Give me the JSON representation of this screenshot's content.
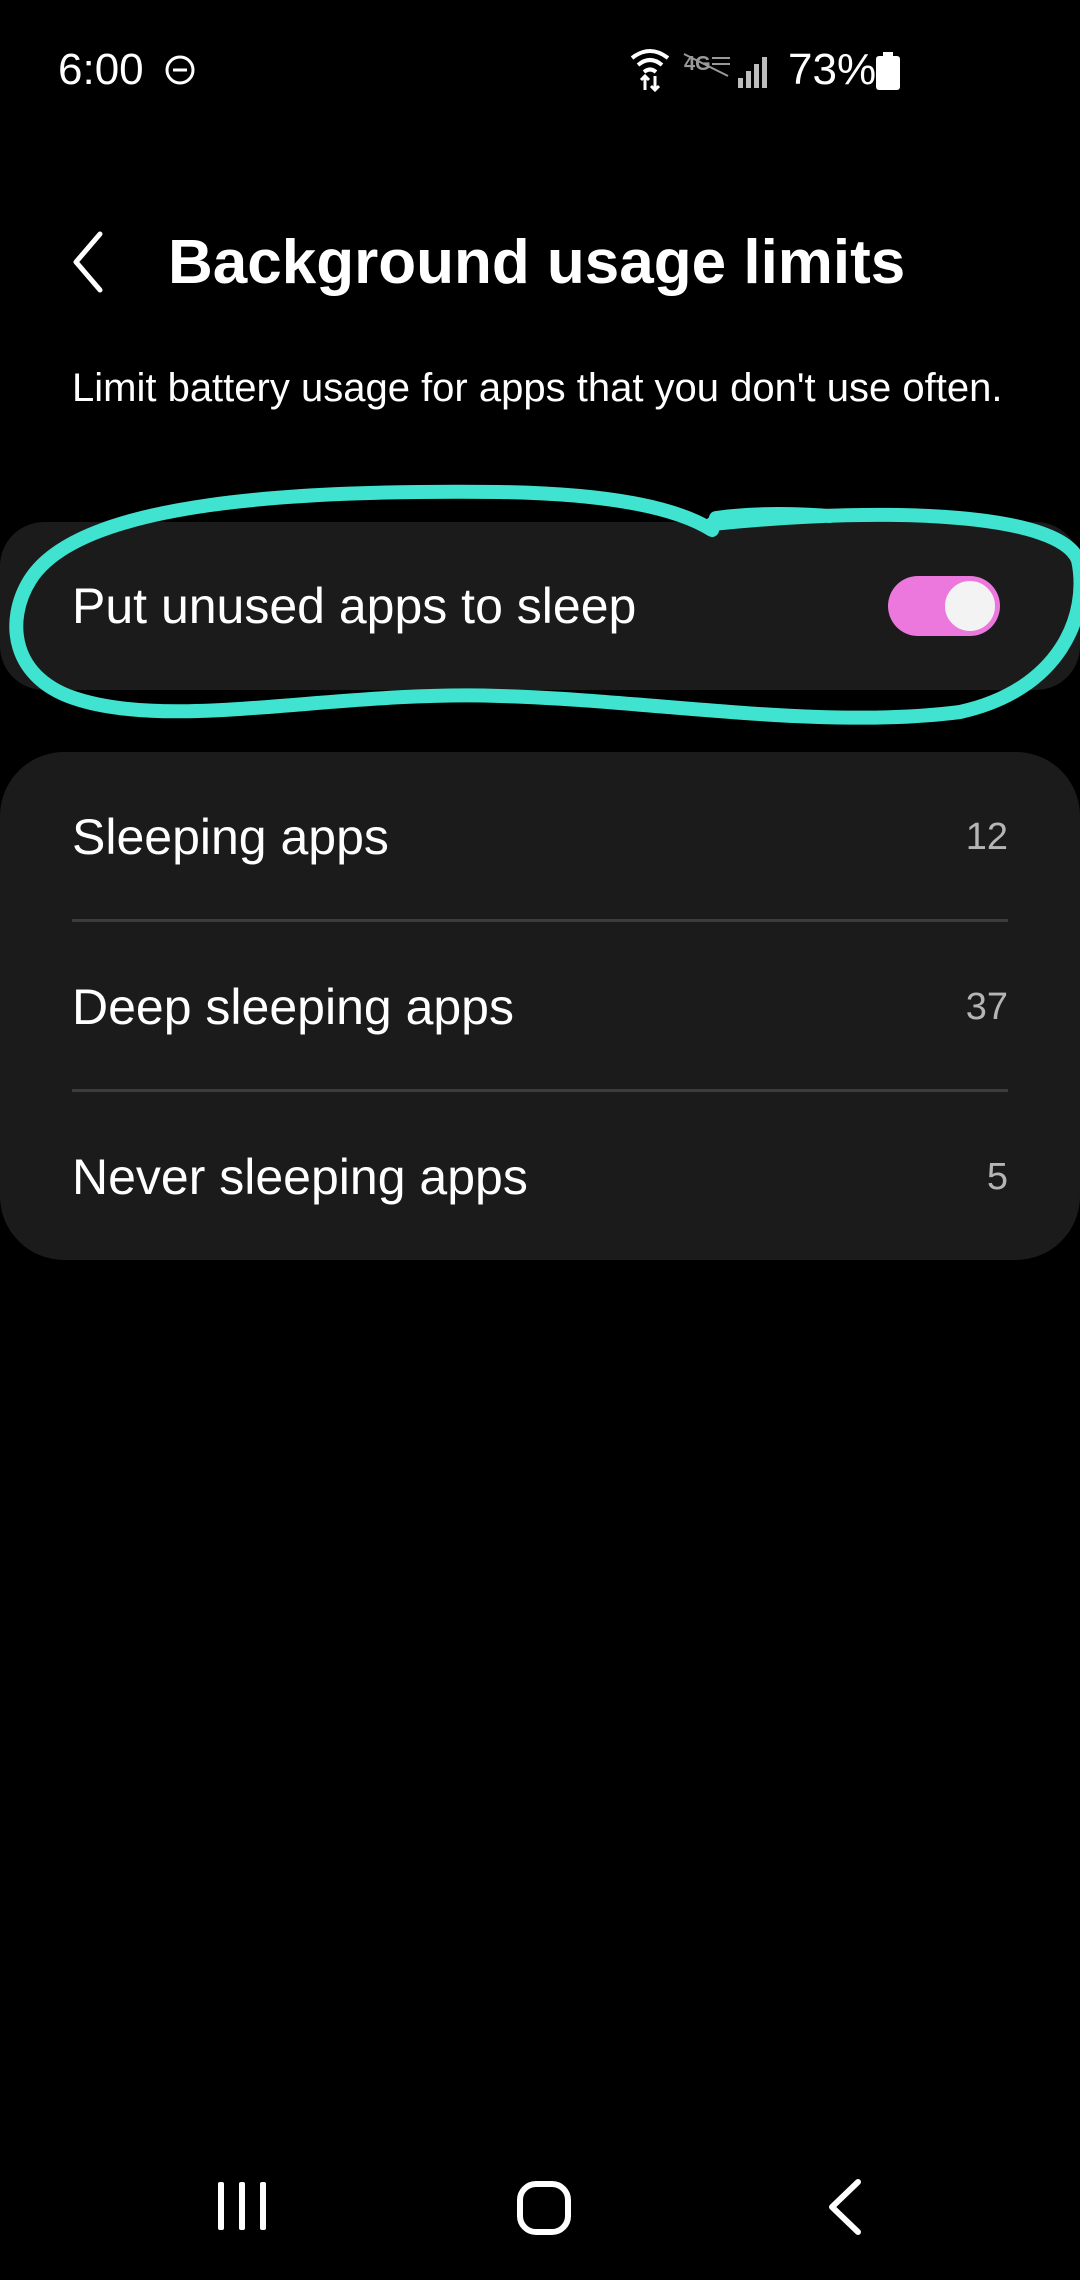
{
  "status_bar": {
    "time": "6:00",
    "battery": "73%",
    "icons": [
      "dnd-icon",
      "wifi-icon",
      "lte-icon",
      "signal-icon",
      "battery-icon"
    ]
  },
  "header": {
    "title": "Background usage limits",
    "back_icon": "chevron-left-icon"
  },
  "description": "Limit battery usage for apps that you don't use often.",
  "sleep_toggle": {
    "label": "Put unused apps to sleep",
    "enabled": true
  },
  "app_lists": [
    {
      "label": "Sleeping apps",
      "count": "12"
    },
    {
      "label": "Deep sleeping apps",
      "count": "37"
    },
    {
      "label": "Never sleeping apps",
      "count": "5"
    }
  ],
  "nav_bar": {
    "icons": [
      "recents-icon",
      "home-icon",
      "back-icon"
    ]
  },
  "colors": {
    "background": "#000000",
    "card": "#1b1b1b",
    "toggle_on": "#ec78de",
    "annotation": "#3fe3cf",
    "secondary_text": "#b5b5b5"
  }
}
